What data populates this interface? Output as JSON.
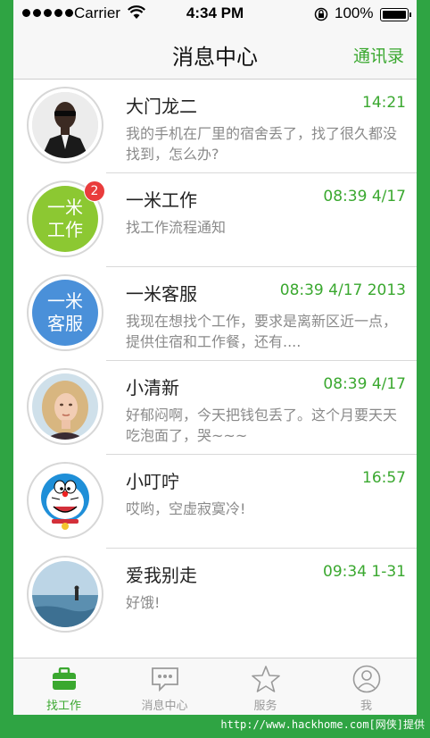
{
  "status_bar": {
    "carrier": "Carrier",
    "time": "4:34 PM",
    "battery": "100%"
  },
  "navbar": {
    "title": "消息中心",
    "contacts_label": "通讯录"
  },
  "messages": [
    {
      "name": "大门龙二",
      "time": "14:21",
      "preview": "我的手机在厂里的宿舍丢了，找了很久都没找到，怎么办?",
      "avatar": "photo-man-icon"
    },
    {
      "name": "一米工作",
      "time": "08:39  4/17",
      "preview": "找工作流程通知",
      "avatar_text": "一米\n工作",
      "avatar_color": "#8cc832",
      "badge": "2"
    },
    {
      "name": "一米客服",
      "time": "08:39  4/17  2013",
      "preview": "我现在想找个工作，要求是离新区近一点，提供住宿和工作餐，还有....",
      "avatar_text": "一米\n客服",
      "avatar_color": "#4a90d9"
    },
    {
      "name": "小清新",
      "time": "08:39  4/17",
      "preview": "好郁闷啊，今天把钱包丢了。这个月要天天吃泡面了，哭~~~",
      "avatar": "photo-woman-icon"
    },
    {
      "name": "小叮咛",
      "time": "16:57",
      "preview": "哎哟，空虚寂寞冷!",
      "avatar": "doraemon-icon"
    },
    {
      "name": "爱我别走",
      "time": "09:34  1-31",
      "preview": "好饿!",
      "avatar": "photo-beach-icon"
    }
  ],
  "tabs": [
    {
      "label": "找工作",
      "icon": "briefcase-icon",
      "active": true
    },
    {
      "label": "消息中心",
      "icon": "chat-bubble-icon",
      "active": false
    },
    {
      "label": "服务",
      "icon": "star-icon",
      "active": false
    },
    {
      "label": "我",
      "icon": "user-icon",
      "active": false
    }
  ],
  "colors": {
    "accent": "#3aa82f",
    "badge": "#e93c3c"
  },
  "watermark": "http://www.hackhome.com[网侠]提供"
}
